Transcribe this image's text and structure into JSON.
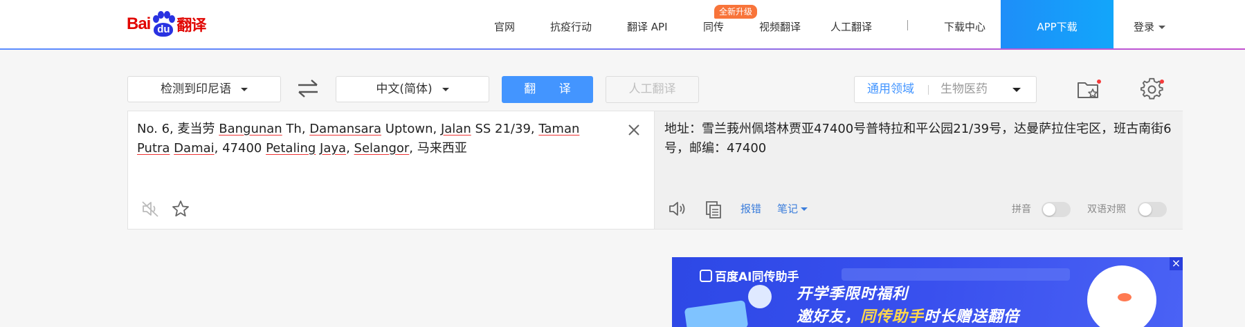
{
  "header": {
    "logo": {
      "text_bai": "Bai",
      "text_du": "du",
      "text_fy": "翻译"
    },
    "nav": [
      {
        "label": "官网"
      },
      {
        "label": "抗疫行动"
      },
      {
        "label": "翻译 API"
      },
      {
        "label": "同传",
        "badge": "全新升级"
      },
      {
        "label": "视频翻译"
      },
      {
        "label": "人工翻译"
      },
      {
        "label": "下载中心"
      }
    ],
    "app_download": "APP下载",
    "login": "登录"
  },
  "toolbar": {
    "source_lang": "检测到印尼语",
    "target_lang": "中文(简体)",
    "translate_btn": "翻 译",
    "human_translate_btn": "人工翻译",
    "domain_label": "通用领域",
    "domain_value": "生物医药"
  },
  "source": {
    "segments": [
      {
        "t": "No. 6, 麦当劳 ",
        "u": false
      },
      {
        "t": "Bangunan",
        "u": true
      },
      {
        "t": " Th, ",
        "u": false
      },
      {
        "t": "Damansara",
        "u": true
      },
      {
        "t": " Uptown, ",
        "u": false
      },
      {
        "t": "Jalan",
        "u": true
      },
      {
        "t": " SS 21/39, ",
        "u": false
      },
      {
        "t": "Taman",
        "u": true
      },
      {
        "t": " ",
        "u": false
      },
      {
        "t": "Putra",
        "u": true
      },
      {
        "t": " ",
        "u": false
      },
      {
        "t": "Damai",
        "u": true
      },
      {
        "t": ", 47400 ",
        "u": false
      },
      {
        "t": "Petaling",
        "u": true
      },
      {
        "t": " ",
        "u": false
      },
      {
        "t": "Jaya",
        "u": true
      },
      {
        "t": ", ",
        "u": false
      },
      {
        "t": "Selangor",
        "u": true
      },
      {
        "t": ", 马来西亚",
        "u": false
      }
    ]
  },
  "target": {
    "text": "地址：雪兰莪州佩塔林贾亚47400号普特拉和平公园21/39号，达曼萨拉住宅区，班古南街6号，邮编：47400",
    "edit_link": "报错",
    "notes_link": "笔记",
    "pinyin_label": "拼音",
    "bilingual_label": "双语对照",
    "pinyin_on": false,
    "bilingual_on": false
  },
  "ad": {
    "brand": "百度AI同传助手",
    "line1": "开学季限时福利",
    "line2_prefix": "邀好友，",
    "line2_highlight": "同传助手",
    "line2_suffix": "时长赠送翻倍"
  },
  "colors": {
    "accent": "#4395ff",
    "brand_red": "#e10602",
    "brand_blue": "#2932e1",
    "badge": "#f8743a"
  }
}
